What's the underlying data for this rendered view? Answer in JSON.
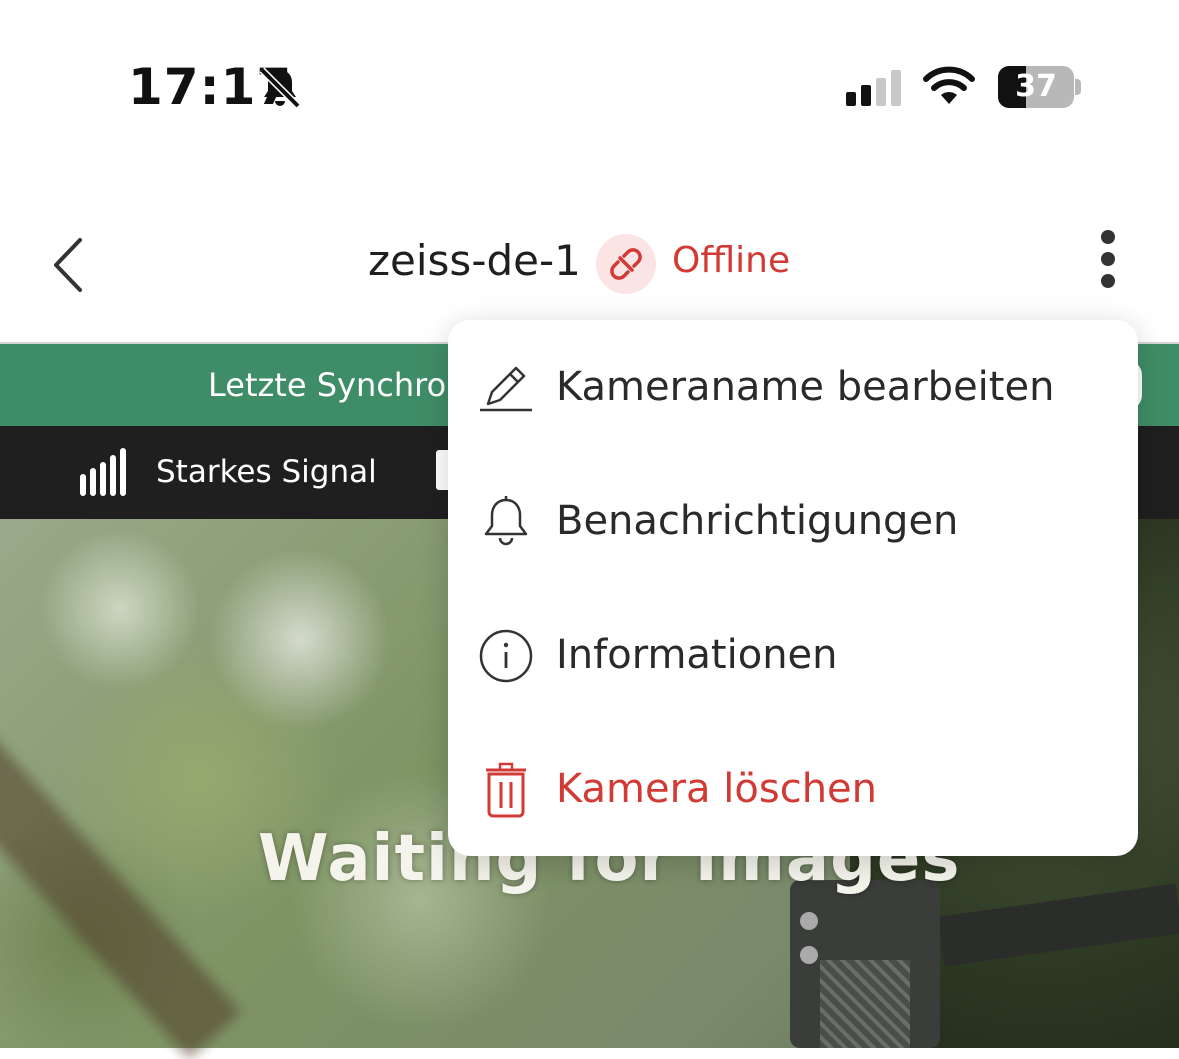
{
  "status_bar": {
    "time": "17:17",
    "battery_percent": "37",
    "battery_level": 0.37,
    "icons": [
      "bell-slash-icon",
      "cellular-signal-icon",
      "wifi-icon",
      "battery-icon"
    ]
  },
  "nav": {
    "title": "zeiss-de-1",
    "status_label": "Offline",
    "status_color": "#d23a35",
    "icons": [
      "chevron-left-icon",
      "link-broken-icon",
      "more-vertical-icon"
    ]
  },
  "sync_banner": {
    "text": "Letzte Synchron",
    "color": "#3f8d66"
  },
  "info_bar": {
    "signal_label": "Starkes Signal",
    "icons": [
      "signal-strength-icon",
      "sd-card-icon"
    ]
  },
  "preview": {
    "overlay_text": "Waiting for images"
  },
  "menu": {
    "items": [
      {
        "label": "Kameraname bearbeiten",
        "icon": "pencil-icon"
      },
      {
        "label": "Benachrichtigungen",
        "icon": "bell-icon"
      },
      {
        "label": "Informationen",
        "icon": "info-icon"
      },
      {
        "label": "Kamera löschen",
        "icon": "trash-icon",
        "color": "#d23a35"
      }
    ]
  }
}
